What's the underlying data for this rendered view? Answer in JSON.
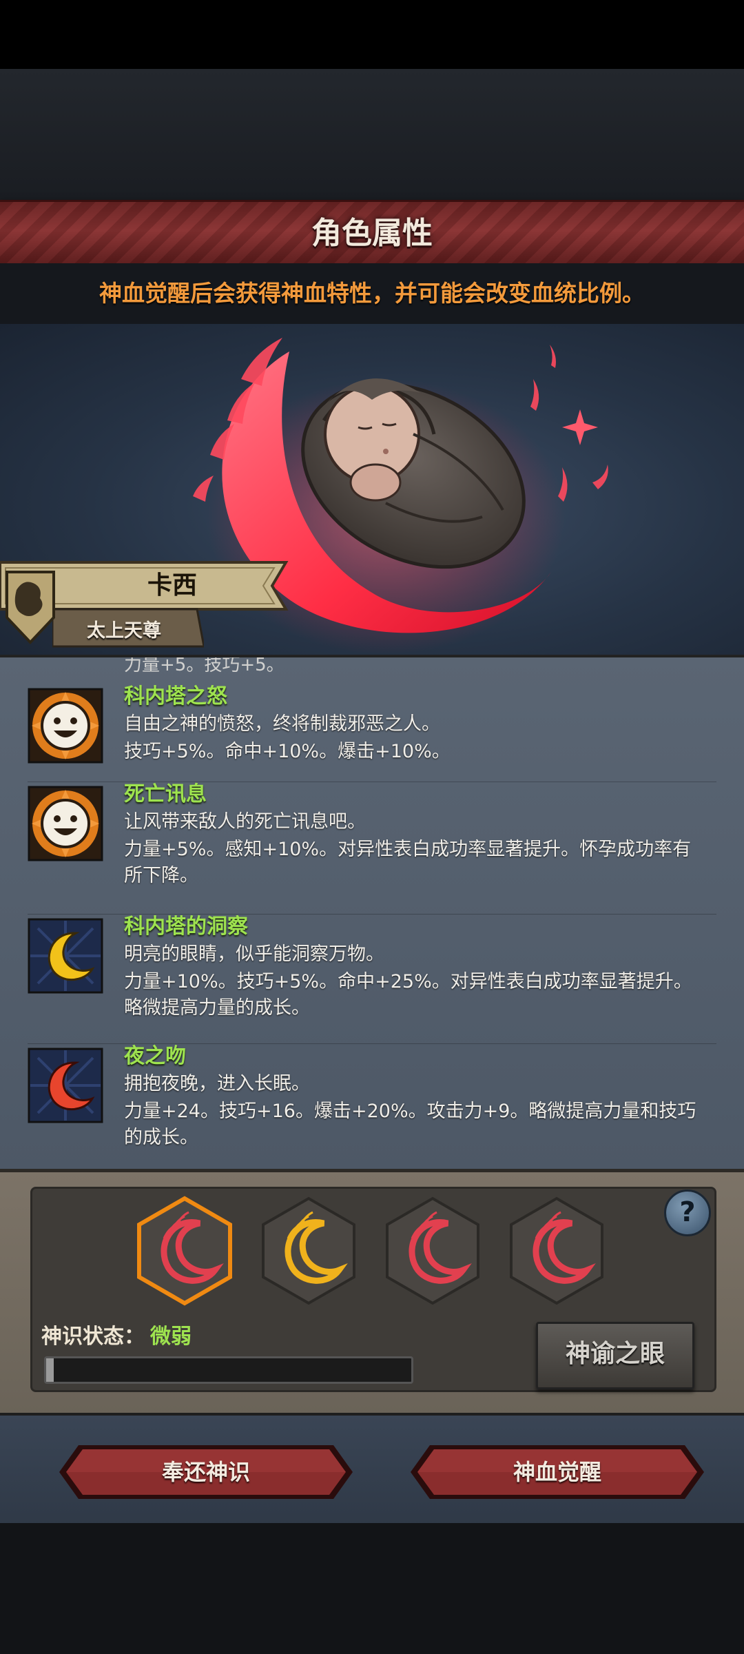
{
  "header": {
    "title": "角色属性",
    "info": "神血觉醒后会获得神血特性，并可能会改变血统比例。"
  },
  "character": {
    "name": "卡西",
    "title": "太上天尊"
  },
  "traits_cutoff_text": "力量+5。技巧+5。",
  "traits": [
    {
      "name": "科内塔之怒",
      "description": "自由之神的愤怒，终将制裁邪恶之人。",
      "effect": "技巧+5%。命中+10%。爆击+10%。",
      "icon": "smiling-sun-icon"
    },
    {
      "name": "死亡讯息",
      "description": "让风带来敌人的死亡讯息吧。",
      "effect": "力量+5%。感知+10%。对异性表白成功率显著提升。怀孕成功率有所下降。",
      "icon": "smiling-sun-icon"
    },
    {
      "name": "科内塔的洞察",
      "description": "明亮的眼睛，似乎能洞察万物。",
      "effect": "力量+10%。技巧+5%。命中+25%。对异性表白成功率显著提升。略微提高力量的成长。",
      "icon": "golden-moon-icon"
    },
    {
      "name": "夜之吻",
      "description": "拥抱夜晚，进入长眠。",
      "effect": "力量+24。技巧+16。爆击+20%。攻击力+9。略微提高力量和技巧的成长。",
      "icon": "red-moon-icon"
    }
  ],
  "bloodline": {
    "status_label": "神识状态：",
    "status_value": "微弱",
    "progress": 0.02,
    "oracle_button": "神谕之眼",
    "help_icon": "question-mark-icon",
    "slots": [
      {
        "color": "#e2404f",
        "selected": true
      },
      {
        "color": "#f0b21c",
        "selected": false
      },
      {
        "color": "#e2404f",
        "selected": false
      },
      {
        "color": "#e2404f",
        "selected": false
      }
    ]
  },
  "actions": {
    "return_label": "奉还神识",
    "awaken_label": "神血觉醒"
  },
  "colors": {
    "accent_orange": "#f39a3c",
    "trait_name_green": "#9ee34f",
    "banner_red": "#7a2a2a",
    "crescent_red": "#ff3b52"
  }
}
